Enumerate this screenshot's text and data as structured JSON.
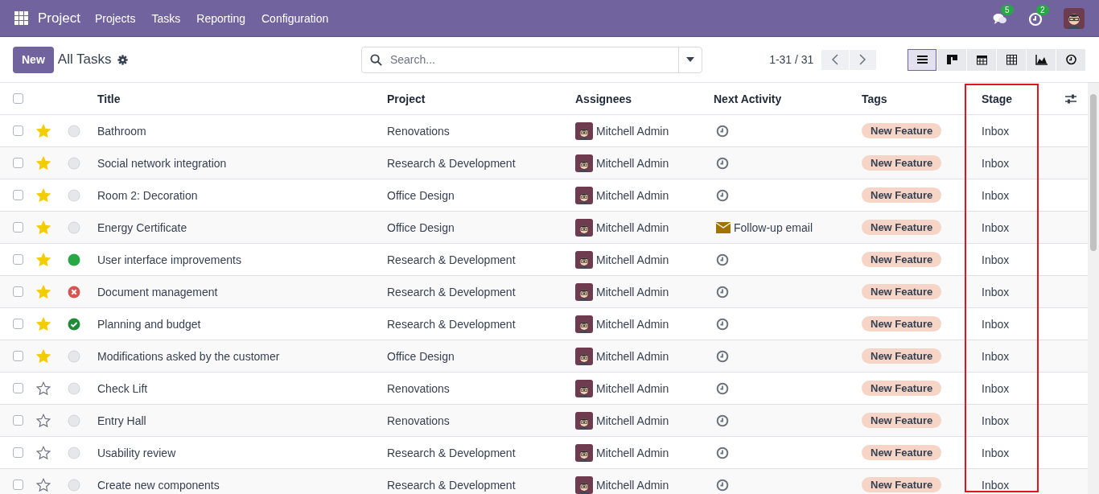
{
  "navbar": {
    "app_name": "Project",
    "menu": [
      "Projects",
      "Tasks",
      "Reporting",
      "Configuration"
    ],
    "messages_count": "5",
    "activities_count": "2"
  },
  "control_panel": {
    "new_button": "New",
    "title": "All Tasks",
    "search": {
      "placeholder": "Search..."
    },
    "pager": "1-31 / 31",
    "views": [
      {
        "kind": "list",
        "selected": true
      },
      {
        "kind": "kanban",
        "selected": false
      },
      {
        "kind": "calendar",
        "selected": false
      },
      {
        "kind": "pivot",
        "selected": false
      },
      {
        "kind": "graph",
        "selected": false
      },
      {
        "kind": "activity",
        "selected": false
      }
    ]
  },
  "table": {
    "select_all_checked": false,
    "columns": [
      {
        "label": "Title",
        "highlighted": false
      },
      {
        "label": "Project",
        "highlighted": false
      },
      {
        "label": "Assignees",
        "highlighted": false
      },
      {
        "label": "Next Activity",
        "highlighted": false
      },
      {
        "label": "Tags",
        "highlighted": false
      },
      {
        "label": "Stage",
        "highlighted": true
      }
    ],
    "rows": [
      {
        "checked": false,
        "starred": true,
        "status_icon": {
          "kind": "normal"
        },
        "title": "Bathroom",
        "project": "Renovations",
        "assignee": "Mitchell Admin",
        "activity": {
          "kind": "clock"
        },
        "tag": "New Feature",
        "stage": "Inbox"
      },
      {
        "checked": false,
        "starred": true,
        "status_icon": {
          "kind": "normal"
        },
        "title": "Social network integration",
        "project": "Research & Development",
        "assignee": "Mitchell Admin",
        "activity": {
          "kind": "clock"
        },
        "tag": "New Feature",
        "stage": "Inbox"
      },
      {
        "checked": false,
        "starred": true,
        "status_icon": {
          "kind": "normal"
        },
        "title": "Room 2: Decoration",
        "project": "Office Design",
        "assignee": "Mitchell Admin",
        "activity": {
          "kind": "clock"
        },
        "tag": "New Feature",
        "stage": "Inbox"
      },
      {
        "checked": false,
        "starred": true,
        "status_icon": {
          "kind": "normal"
        },
        "title": "Energy Certificate",
        "project": "Office Design",
        "assignee": "Mitchell Admin",
        "activity": {
          "kind": "email",
          "label": "Follow-up email"
        },
        "tag": "New Feature",
        "stage": "Inbox"
      },
      {
        "checked": false,
        "starred": true,
        "status_icon": {
          "kind": "done"
        },
        "title": "User interface improvements",
        "project": "Research & Development",
        "assignee": "Mitchell Admin",
        "activity": {
          "kind": "clock"
        },
        "tag": "New Feature",
        "stage": "Inbox"
      },
      {
        "checked": false,
        "starred": true,
        "status_icon": {
          "kind": "blocked"
        },
        "title": "Document management",
        "project": "Research & Development",
        "assignee": "Mitchell Admin",
        "activity": {
          "kind": "clock"
        },
        "tag": "New Feature",
        "stage": "Inbox"
      },
      {
        "checked": false,
        "starred": true,
        "status_icon": {
          "kind": "approved"
        },
        "title": "Planning and budget",
        "project": "Research & Development",
        "assignee": "Mitchell Admin",
        "activity": {
          "kind": "clock"
        },
        "tag": "New Feature",
        "stage": "Inbox"
      },
      {
        "checked": false,
        "starred": true,
        "status_icon": {
          "kind": "normal"
        },
        "title": "Modifications asked by the customer",
        "project": "Office Design",
        "assignee": "Mitchell Admin",
        "activity": {
          "kind": "clock"
        },
        "tag": "New Feature",
        "stage": "Inbox"
      },
      {
        "checked": false,
        "starred": false,
        "status_icon": {
          "kind": "normal"
        },
        "title": "Check Lift",
        "project": "Renovations",
        "assignee": "Mitchell Admin",
        "activity": {
          "kind": "clock"
        },
        "tag": "New Feature",
        "stage": "Inbox"
      },
      {
        "checked": false,
        "starred": false,
        "status_icon": {
          "kind": "normal"
        },
        "title": "Entry Hall",
        "project": "Renovations",
        "assignee": "Mitchell Admin",
        "activity": {
          "kind": "clock"
        },
        "tag": "New Feature",
        "stage": "Inbox"
      },
      {
        "checked": false,
        "starred": false,
        "status_icon": {
          "kind": "normal"
        },
        "title": "Usability review",
        "project": "Research & Development",
        "assignee": "Mitchell Admin",
        "activity": {
          "kind": "clock"
        },
        "tag": "New Feature",
        "stage": "Inbox"
      },
      {
        "checked": false,
        "starred": false,
        "status_icon": {
          "kind": "normal"
        },
        "title": "Create new components",
        "project": "Research & Development",
        "assignee": "Mitchell Admin",
        "activity": {
          "kind": "clock"
        },
        "tag": "New Feature",
        "stage": "Inbox"
      }
    ]
  }
}
